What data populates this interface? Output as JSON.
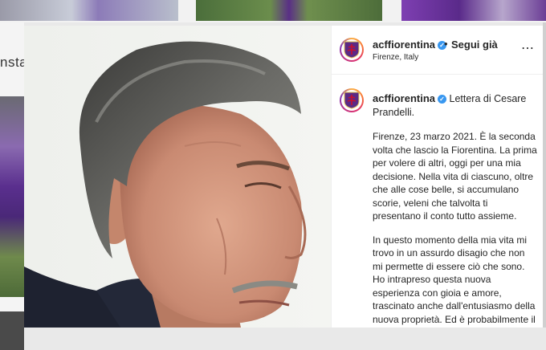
{
  "post": {
    "username": "acffiorentina",
    "separator": "•",
    "follow_label": "Segui già",
    "location": "Firenze, Italy",
    "more_icon": "⋯",
    "verified_icon": "✓",
    "caption_title": "Lettera di Cesare Prandelli.",
    "caption_paragraphs": [
      "Firenze, 23 marzo 2021. È la seconda volta che lascio la Fiorentina. La prima per volere di altri, oggi per una mia decisione. Nella vita di ciascuno, oltre che alle cose belle, si accumulano scorie, veleni che talvolta ti presentano il conto tutto assieme.",
      "In questo momento della mia vita mi trovo in un assurdo disagio che non mi permette di essere ciò che sono. Ho intrapreso questa nuova esperienza con gioia e amore, trascinato anche dall'entusiasmo della nuova proprietà. Ed è probabilmente il troppo amore per la città, per il ricordo dei bei"
    ]
  },
  "background": {
    "left_partial_text": "nsta"
  },
  "colors": {
    "verified": "#3897f0",
    "fiorentina_purple": "#5b2a86",
    "text": "#262626"
  },
  "icons": [
    "fiorentina-logo-icon",
    "verified-badge-icon",
    "more-options-icon"
  ]
}
